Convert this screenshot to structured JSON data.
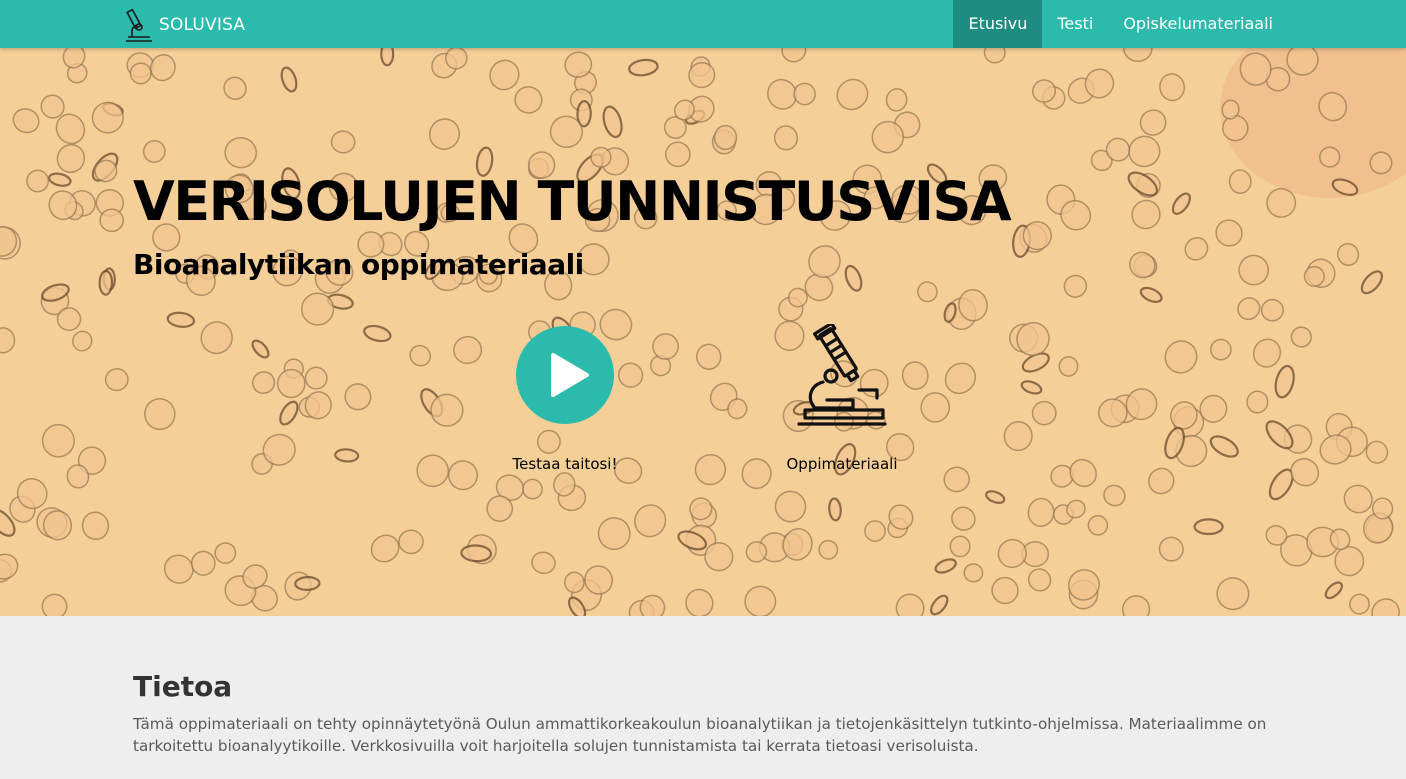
{
  "brand": {
    "name": "SOLUVISA",
    "icon": "microscope-icon"
  },
  "nav": {
    "items": [
      {
        "label": "Etusivu",
        "active": true
      },
      {
        "label": "Testi",
        "active": false
      },
      {
        "label": "Opiskelumateriaali",
        "active": false
      }
    ]
  },
  "hero": {
    "title": "VERISOLUJEN TUNNISTUSVISA",
    "subtitle": "Bioanalytiikan oppimateriaali",
    "actions": {
      "test_label": "Testaa taitosi!",
      "test_icon": "play-icon",
      "material_label": "Oppimateriaali",
      "material_icon": "microscope-icon"
    }
  },
  "about": {
    "title": "Tietoa",
    "text": "Tämä oppimateriaali on tehty opinnäytetyönä Oulun ammattikorkeakoulun bioanalytiikan ja tietojenkäsittelyn tutkinto-ohjelmissa. Materiaalimme on tarkoitettu bioanalyytikoille. Verkkosivuilla voit harjoitella solujen tunnistamista tai kerrata tietoasi verisoluista."
  },
  "colors": {
    "accent": "#2bbbad",
    "nav_active": "#1e8c80",
    "hero_background": "#f5cf98",
    "about_background": "#eeeeee"
  }
}
